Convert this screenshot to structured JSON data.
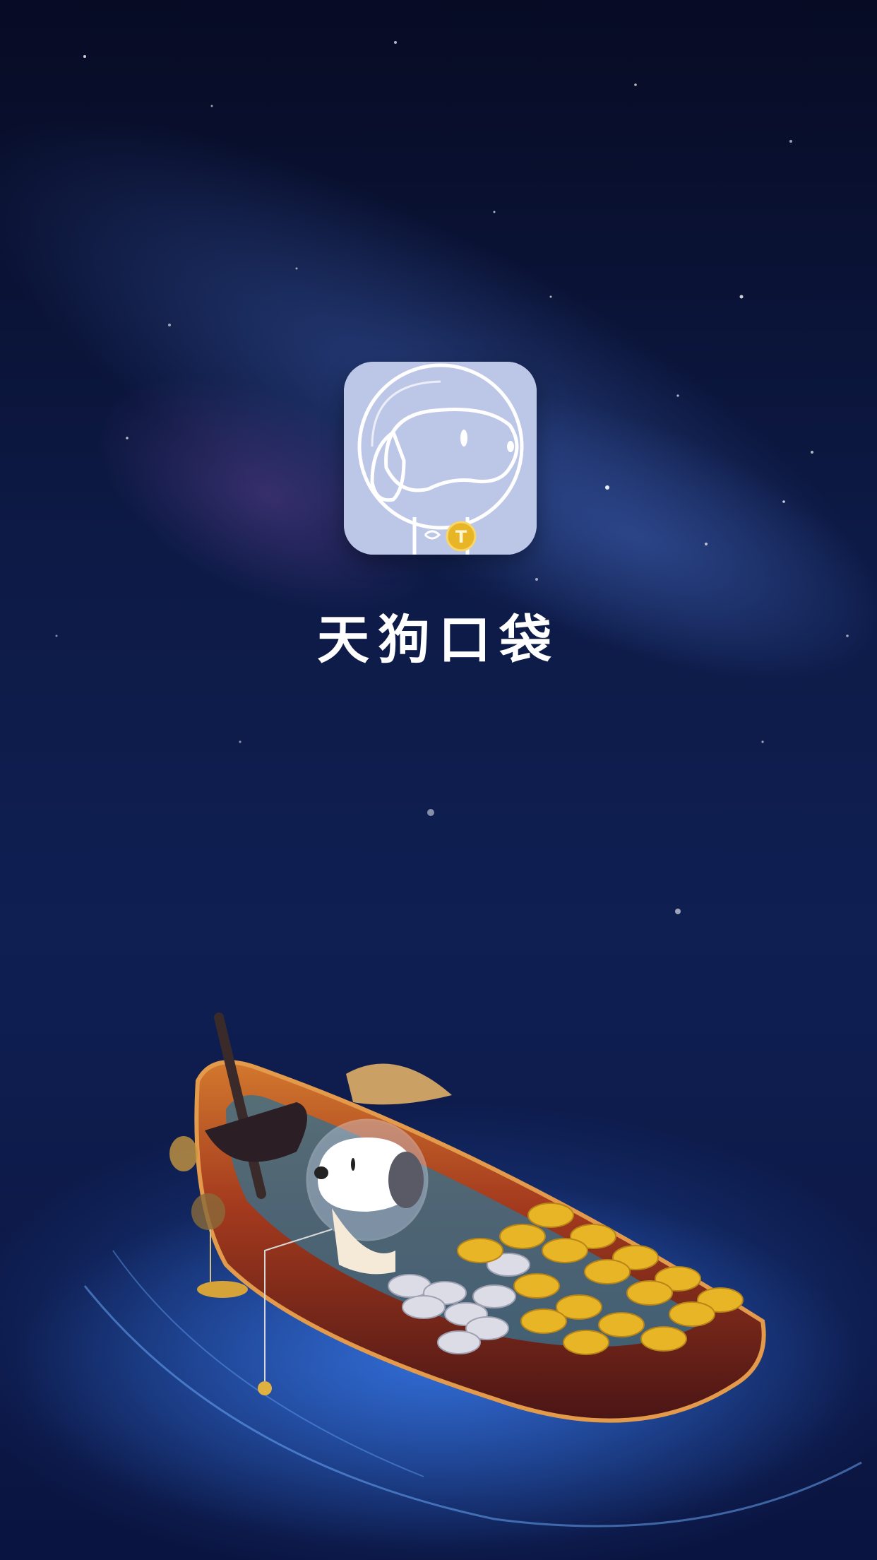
{
  "splash": {
    "app_name": "天狗口袋",
    "logo_icon": "astronaut-dog-icon",
    "scene": "dog-in-boat-with-coins-illustration"
  },
  "colors": {
    "background_top": "#070b24",
    "background_mid": "#12245a",
    "logo_bg": "#bcc6e7",
    "coin_gold": "#e8b526",
    "boat_wood": "#a43a1e",
    "title_text": "#ffffff"
  }
}
